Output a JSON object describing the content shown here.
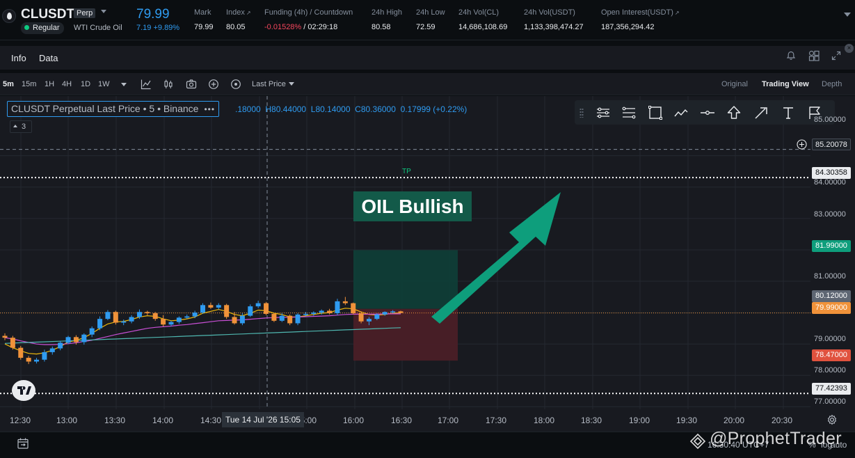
{
  "ticker": {
    "symbol": "CLUSDT",
    "contract_type": "Perp",
    "session": "Regular",
    "description": "WTI Crude Oil",
    "last_price": "79.99",
    "change": "7.19 +9.89%",
    "stats": [
      {
        "label": "Mark",
        "value": "79.99",
        "ext": ""
      },
      {
        "label": "Index",
        "value": "80.05",
        "ext": "↗"
      },
      {
        "label": "Funding (4h) / Countdown",
        "value": "-0.01528%",
        "value2": " / 02:29:18",
        "ext": ""
      },
      {
        "label": "24h High",
        "value": "80.58",
        "ext": ""
      },
      {
        "label": "24h Low",
        "value": "72.59",
        "ext": ""
      },
      {
        "label": "24h Vol(CL)",
        "value": "14,686,108.69",
        "ext": ""
      },
      {
        "label": "24h Vol(USDT)",
        "value": "1,133,398,474.27",
        "ext": ""
      },
      {
        "label": "Open Interest(USDT)",
        "value": "187,356,294.42",
        "ext": "↗"
      }
    ]
  },
  "tabs": [
    "Info",
    "Data"
  ],
  "toolbar": {
    "intervals": [
      "5m",
      "15m",
      "1H",
      "4H",
      "1D",
      "1W"
    ],
    "active_interval": "5m",
    "price_type": "Last Price",
    "views": [
      "Original",
      "Trading View",
      "Depth"
    ],
    "active_view": "Trading View"
  },
  "chart": {
    "legend_title": "CLUSDT Perpetual Last Price • 5 • Binance",
    "legend_more": "•••",
    "ohlc": {
      "o": ".18000",
      "h": "H80.44000",
      "l": "L80.14000",
      "c": "C80.36000",
      "chg": "0.17999 (+0.22%)"
    },
    "indicator_count": "3",
    "annotation_tp": "TP",
    "annotation_text": "OIL Bullish",
    "crosshair_time": "Tue 14 Jul '26   15:05",
    "colors": {
      "up": "#2f9bf0",
      "down": "#f0923a",
      "profit_zone": "#0f3d37",
      "loss_zone": "#4a1f27",
      "arrow": "#0e9e7c",
      "label_bg": "#135a49"
    }
  },
  "chart_data": {
    "type": "candlestick",
    "y_axis_ticks": [
      "85.00000",
      "84.00000",
      "83.00000",
      "81.00000",
      "79.00000",
      "78.00000",
      "77.00000"
    ],
    "x_axis_ticks": [
      "12:30",
      "13:00",
      "13:30",
      "14:00",
      "14:30",
      "15:00",
      "16:00",
      "16:30",
      "17:00",
      "17:30",
      "18:00",
      "18:30",
      "19:00",
      "19:30",
      "20:00",
      "20:30"
    ],
    "ylim": [
      76.92,
      86.9
    ],
    "price_tags": [
      {
        "value": "85.20078",
        "kind": "crosshair"
      },
      {
        "value": "84.30358",
        "kind": "level"
      },
      {
        "value": "81.99000",
        "kind": "target"
      },
      {
        "value": "80.12000",
        "kind": "entry"
      },
      {
        "value": "79.99000",
        "kind": "last"
      },
      {
        "value": "78.47000",
        "kind": "stop"
      },
      {
        "value": "77.42393",
        "kind": "level"
      }
    ],
    "levels": {
      "tp": 84.30358,
      "sl": 77.42393,
      "crosshair": 85.20078,
      "last": 79.99
    },
    "position": {
      "target": 81.99,
      "entry": 80.12,
      "stop": 78.47
    },
    "candles": [
      [
        79.26,
        79.34,
        79.12,
        79.2
      ],
      [
        79.2,
        79.26,
        78.82,
        78.88
      ],
      [
        78.88,
        78.94,
        78.5,
        78.56
      ],
      [
        78.56,
        78.62,
        78.36,
        78.44
      ],
      [
        78.44,
        78.56,
        78.38,
        78.5
      ],
      [
        78.5,
        78.82,
        78.44,
        78.74
      ],
      [
        78.74,
        78.92,
        78.66,
        78.86
      ],
      [
        78.86,
        79.1,
        78.8,
        79.04
      ],
      [
        79.04,
        79.26,
        79.0,
        79.22
      ],
      [
        79.22,
        79.28,
        78.98,
        79.06
      ],
      [
        79.06,
        79.34,
        78.98,
        79.3
      ],
      [
        79.3,
        79.56,
        79.22,
        79.5
      ],
      [
        79.5,
        79.88,
        79.44,
        79.8
      ],
      [
        79.8,
        80.08,
        79.76,
        80.02
      ],
      [
        80.02,
        80.06,
        79.62,
        79.68
      ],
      [
        79.68,
        79.78,
        79.6,
        79.72
      ],
      [
        79.72,
        79.92,
        79.66,
        79.86
      ],
      [
        79.86,
        80.1,
        79.8,
        80.02
      ],
      [
        80.02,
        80.06,
        79.92,
        79.98
      ],
      [
        79.98,
        80.02,
        79.74,
        79.8
      ],
      [
        79.8,
        79.92,
        79.56,
        79.62
      ],
      [
        79.62,
        79.74,
        79.56,
        79.7
      ],
      [
        79.7,
        79.88,
        79.64,
        79.84
      ],
      [
        79.84,
        79.94,
        79.8,
        79.88
      ],
      [
        79.88,
        80.06,
        79.82,
        80.0
      ],
      [
        80.0,
        80.3,
        79.96,
        80.24
      ],
      [
        80.24,
        80.32,
        80.12,
        80.16
      ],
      [
        80.16,
        80.3,
        80.1,
        80.24
      ],
      [
        80.24,
        80.28,
        79.8,
        79.86
      ],
      [
        79.86,
        80.02,
        79.62,
        79.66
      ],
      [
        79.66,
        79.98,
        79.6,
        79.9
      ],
      [
        79.9,
        80.26,
        79.86,
        80.2
      ],
      [
        80.2,
        80.38,
        80.14,
        80.3
      ],
      [
        80.3,
        80.34,
        79.92,
        79.96
      ],
      [
        79.96,
        79.98,
        79.7,
        79.74
      ],
      [
        79.74,
        79.98,
        79.7,
        79.9
      ],
      [
        79.9,
        79.94,
        79.6,
        79.66
      ],
      [
        79.66,
        79.98,
        79.6,
        79.94
      ],
      [
        79.94,
        80.02,
        79.88,
        79.96
      ],
      [
        79.96,
        80.04,
        79.9,
        80.0
      ],
      [
        80.0,
        80.1,
        79.94,
        80.06
      ],
      [
        80.06,
        80.12,
        79.94,
        79.98
      ],
      [
        79.98,
        80.44,
        79.92,
        80.36
      ],
      [
        80.36,
        80.5,
        80.24,
        80.3
      ],
      [
        80.3,
        80.32,
        79.94,
        79.98
      ],
      [
        79.98,
        80.04,
        79.66,
        79.72
      ],
      [
        79.72,
        79.86,
        79.6,
        79.8
      ],
      [
        79.8,
        79.98,
        79.76,
        79.94
      ],
      [
        79.94,
        80.04,
        79.9,
        80.02
      ],
      [
        80.02,
        80.08,
        79.98,
        80.04
      ],
      [
        80.04,
        80.06,
        79.98,
        79.99
      ]
    ],
    "ma_series": [
      {
        "color": "#f0b90b",
        "values": [
          79.0,
          78.88,
          78.78,
          78.7,
          78.68,
          78.72,
          78.8,
          78.92,
          79.06,
          79.12,
          79.2,
          79.34,
          79.5,
          79.64,
          79.7,
          79.72,
          79.78,
          79.86,
          79.9,
          79.88,
          79.8,
          79.74,
          79.76,
          79.8,
          79.86,
          79.98,
          80.04,
          80.1,
          80.04,
          79.94,
          79.9,
          79.98,
          80.08,
          80.06,
          79.98,
          79.94,
          79.86,
          79.86,
          79.9,
          79.94,
          79.98,
          80.0,
          80.08,
          80.14,
          80.12,
          80.02,
          79.94,
          79.92,
          79.94,
          79.98,
          79.99
        ]
      },
      {
        "color": "#c94fd6",
        "values": [
          79.2,
          79.16,
          79.1,
          79.05,
          79.0,
          78.98,
          78.98,
          78.99,
          79.01,
          79.04,
          79.08,
          79.12,
          79.18,
          79.24,
          79.3,
          79.35,
          79.4,
          79.45,
          79.5,
          79.53,
          79.55,
          79.57,
          79.6,
          79.62,
          79.65,
          79.68,
          79.71,
          79.74,
          79.75,
          79.76,
          79.77,
          79.79,
          79.81,
          79.83,
          79.84,
          79.85,
          79.85,
          79.86,
          79.87,
          79.88,
          79.89,
          79.9,
          79.92,
          79.94,
          79.95,
          79.95,
          79.95,
          79.95,
          79.96,
          79.96,
          79.96
        ]
      },
      {
        "color": "#4fb7b0",
        "values": [
          79.02,
          79.03,
          79.04,
          79.05,
          79.06,
          79.07,
          79.08,
          79.09,
          79.1,
          79.11,
          79.12,
          79.13,
          79.14,
          79.15,
          79.16,
          79.17,
          79.18,
          79.19,
          79.2,
          79.21,
          79.22,
          79.23,
          79.24,
          79.25,
          79.26,
          79.27,
          79.28,
          79.29,
          79.3,
          79.31,
          79.32,
          79.33,
          79.34,
          79.35,
          79.36,
          79.37,
          79.38,
          79.39,
          79.4,
          79.41,
          79.42,
          79.43,
          79.44,
          79.45,
          79.46,
          79.47,
          79.48,
          79.49,
          79.5,
          79.51,
          79.52
        ]
      }
    ]
  },
  "bottom": {
    "clock": "16:30:40 UTC+7",
    "pct": "%",
    "log": "log",
    "auto": "auto",
    "watermark": "@ProphetTrader"
  }
}
